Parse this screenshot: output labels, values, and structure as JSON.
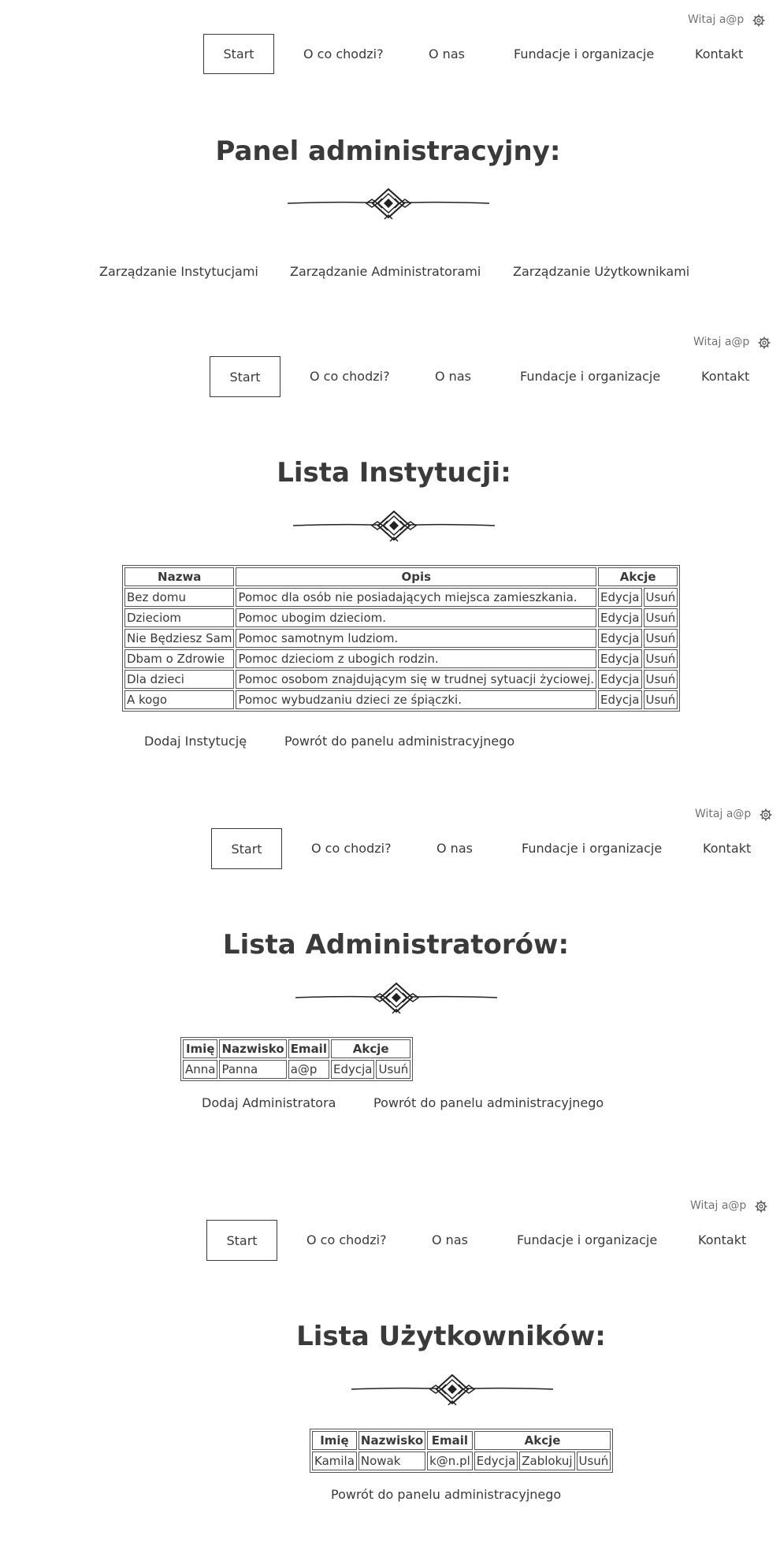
{
  "header": {
    "greeting": "Witaj a@p",
    "settings_icon": "gear-icon",
    "nav": [
      "Start",
      "O co chodzi?",
      "O nas",
      "Fundacje i organizacje",
      "Kontakt"
    ]
  },
  "panel": {
    "title": "Panel administracyjny:",
    "links": [
      "Zarządzanie Instytucjami",
      "Zarządzanie Administratorami",
      "Zarządzanie Użytkownikami"
    ]
  },
  "institutions": {
    "title": "Lista Instytucji:",
    "columns": [
      "Nazwa",
      "Opis",
      "Akcje"
    ],
    "rows": [
      {
        "name": "Bez domu",
        "desc": "Pomoc dla osób nie posiadających miejsca zamieszkania.",
        "edit": "Edycja",
        "delete": "Usuń"
      },
      {
        "name": "Dzieciom",
        "desc": "Pomoc ubogim dzieciom.",
        "edit": "Edycja",
        "delete": "Usuń"
      },
      {
        "name": "Nie Będziesz Sam",
        "desc": "Pomoc samotnym ludziom.",
        "edit": "Edycja",
        "delete": "Usuń"
      },
      {
        "name": "Dbam o Zdrowie",
        "desc": "Pomoc dzieciom z ubogich rodzin.",
        "edit": "Edycja",
        "delete": "Usuń"
      },
      {
        "name": "Dla dzieci",
        "desc": "Pomoc osobom znajdującym się w trudnej sytuacji życiowej.",
        "edit": "Edycja",
        "delete": "Usuń"
      },
      {
        "name": "A kogo",
        "desc": "Pomoc wybudzaniu dzieci ze śpiączki.",
        "edit": "Edycja",
        "delete": "Usuń"
      }
    ],
    "add_link": "Dodaj Instytucję",
    "back_link": "Powrót do panelu administracyjnego"
  },
  "admins": {
    "title": "Lista Administratorów:",
    "columns": [
      "Imię",
      "Nazwisko",
      "Email",
      "Akcje"
    ],
    "rows": [
      {
        "first": "Anna",
        "last": "Panna",
        "email": "a@p",
        "edit": "Edycja",
        "delete": "Usuń"
      }
    ],
    "add_link": "Dodaj Administratora",
    "back_link": "Powrót do panelu administracyjnego"
  },
  "users": {
    "title": "Lista Użytkowników:",
    "columns": [
      "Imię",
      "Nazwisko",
      "Email",
      "Akcje"
    ],
    "rows": [
      {
        "first": "Kamila",
        "last": "Nowak",
        "email": "k@n.pl",
        "edit": "Edycja",
        "block": "Zablokuj",
        "delete": "Usuń"
      }
    ],
    "back_link": "Powrót do panelu administracyjnego"
  }
}
